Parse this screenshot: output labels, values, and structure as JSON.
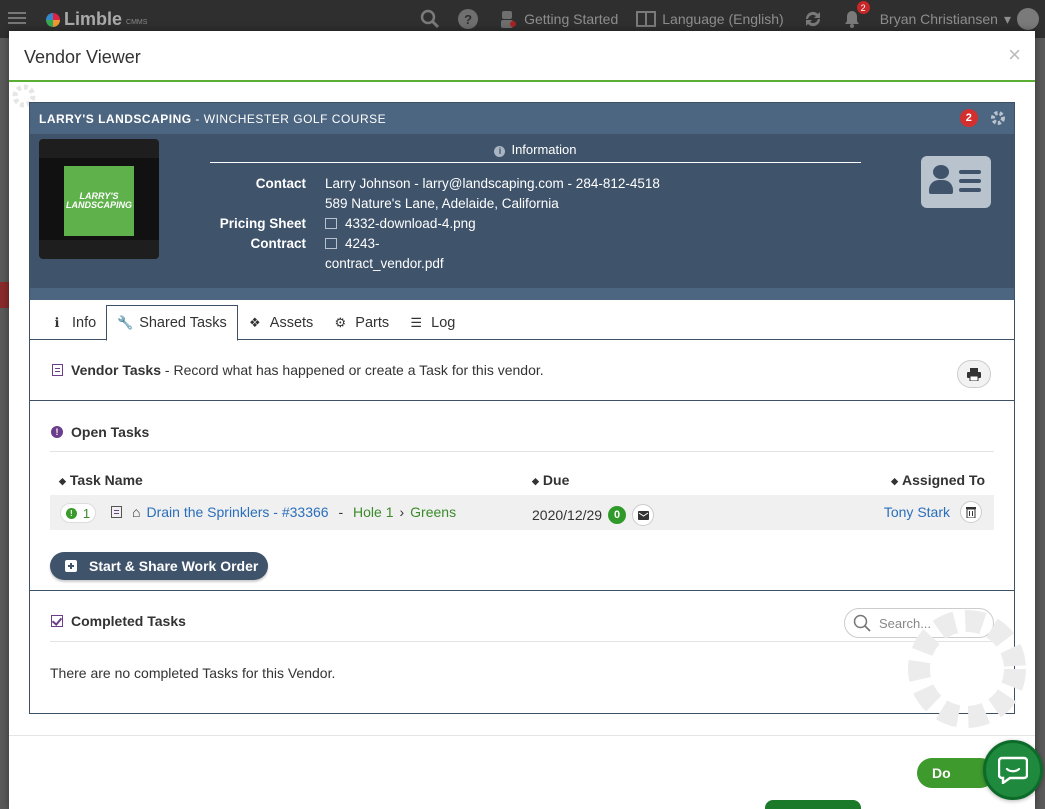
{
  "topbar": {
    "logo_text": "Limble",
    "logo_sub": "CMMS",
    "getting_started": "Getting Started",
    "language": "Language (English)",
    "notif_count": "2",
    "user_name": "Bryan Christiansen"
  },
  "modal": {
    "title": "Vendor Viewer",
    "close_label": "×"
  },
  "vendor": {
    "name": "LARRY'S LANDSCAPING",
    "separator": " - ",
    "location": "WINCHESTER GOLF COURSE",
    "badge_count": "2",
    "logo_line1": "LARRY'S",
    "logo_line2": "LANDSCAPING",
    "info_title": "Information",
    "contact_label": "Contact",
    "contact_value": "Larry Johnson - larry@landscaping.com - 284-812-4518",
    "address": "589 Nature's Lane, Adelaide, California",
    "pricing_label": "Pricing Sheet",
    "pricing_file": "4332-download-4.png",
    "contract_label": "Contract",
    "contract_file_line1": "4243-",
    "contract_file_line2": "contract_vendor.pdf"
  },
  "tabs": [
    {
      "label": "Info",
      "icon": "info-icon"
    },
    {
      "label": "Shared Tasks",
      "icon": "wrench-icon"
    },
    {
      "label": "Assets",
      "icon": "cubes-icon"
    },
    {
      "label": "Parts",
      "icon": "gears-icon"
    },
    {
      "label": "Log",
      "icon": "list-icon"
    }
  ],
  "vendor_tasks": {
    "title": "Vendor Tasks",
    "description": " - Record what has happened or create a Task for this vendor."
  },
  "open_tasks": {
    "title": "Open Tasks",
    "columns": {
      "name": "Task Name",
      "due": "Due",
      "assigned": "Assigned To"
    },
    "rows": [
      {
        "priority": "1",
        "task_name": "Drain the Sprinklers - #33366",
        "location_sep": " - ",
        "location": "Hole 1",
        "arrow": "›",
        "sublocation": "Greens",
        "due": "2020/12/29",
        "comments": "0",
        "assigned_to": "Tony Stark"
      }
    ],
    "start_button": "Start & Share Work Order"
  },
  "completed_tasks": {
    "title": "Completed Tasks",
    "search_placeholder": "Search...",
    "empty_message": "There are no completed Tasks for this Vendor."
  },
  "footer": {
    "done_label": "Do"
  },
  "colors": {
    "banner": "#3f536b",
    "accent_green": "#5aae34",
    "link_blue": "#2a6ebb",
    "purple": "#6b3d8a"
  }
}
